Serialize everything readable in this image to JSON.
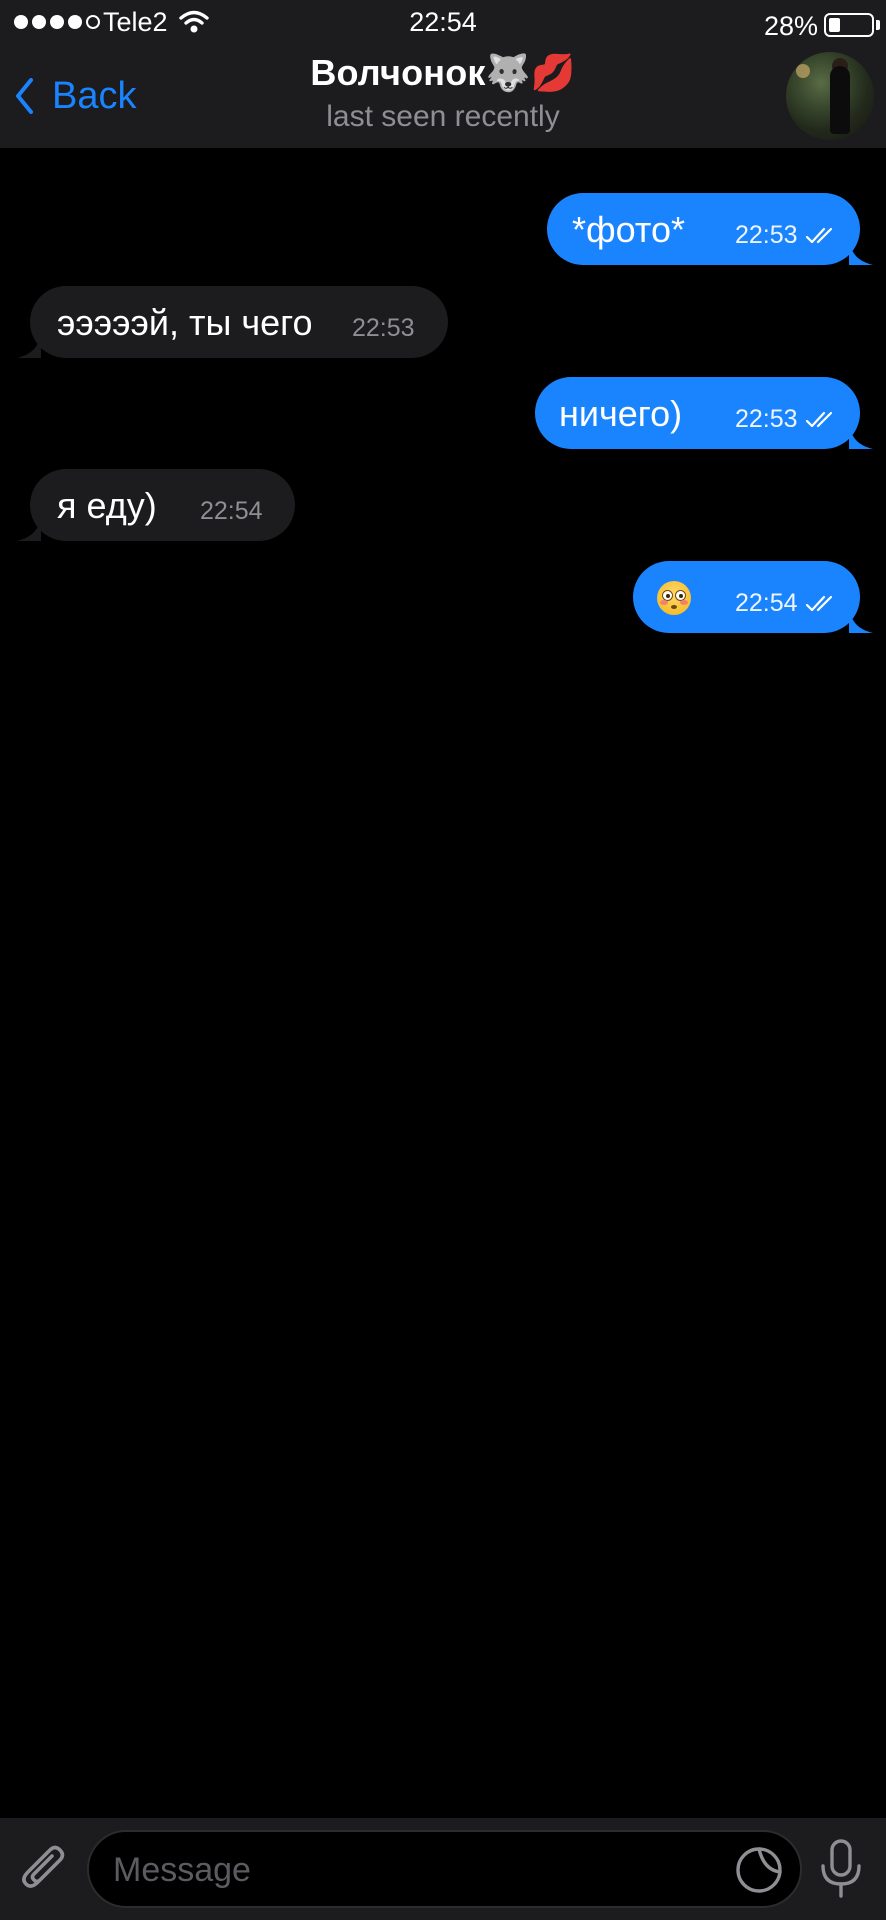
{
  "status_bar": {
    "carrier": "Tele2",
    "time": "22:54",
    "battery_percent_text": "28%",
    "battery_level": 0.28,
    "signal_bars_filled": 4,
    "signal_bars_total": 5
  },
  "header": {
    "back_label": "Back",
    "title": "Волчонок🐺💋",
    "subtitle": "last seen recently"
  },
  "messages": [
    {
      "direction": "outgoing",
      "text": "*фото*",
      "time": "22:53",
      "read": true
    },
    {
      "direction": "incoming",
      "text": "эээээй, ты чего",
      "time": "22:53"
    },
    {
      "direction": "outgoing",
      "text": "ничего)",
      "time": "22:53",
      "read": true
    },
    {
      "direction": "incoming",
      "text": "я еду)",
      "time": "22:54"
    },
    {
      "direction": "outgoing",
      "text": "😳",
      "time": "22:54",
      "read": true,
      "icon": "flushed-face-emoji"
    }
  ],
  "composer": {
    "placeholder": "Message",
    "value": ""
  },
  "colors": {
    "accent": "#1a84ff",
    "bar_background": "#1c1c1e",
    "chat_background": "#000000",
    "secondary_text": "#8e8e93"
  }
}
